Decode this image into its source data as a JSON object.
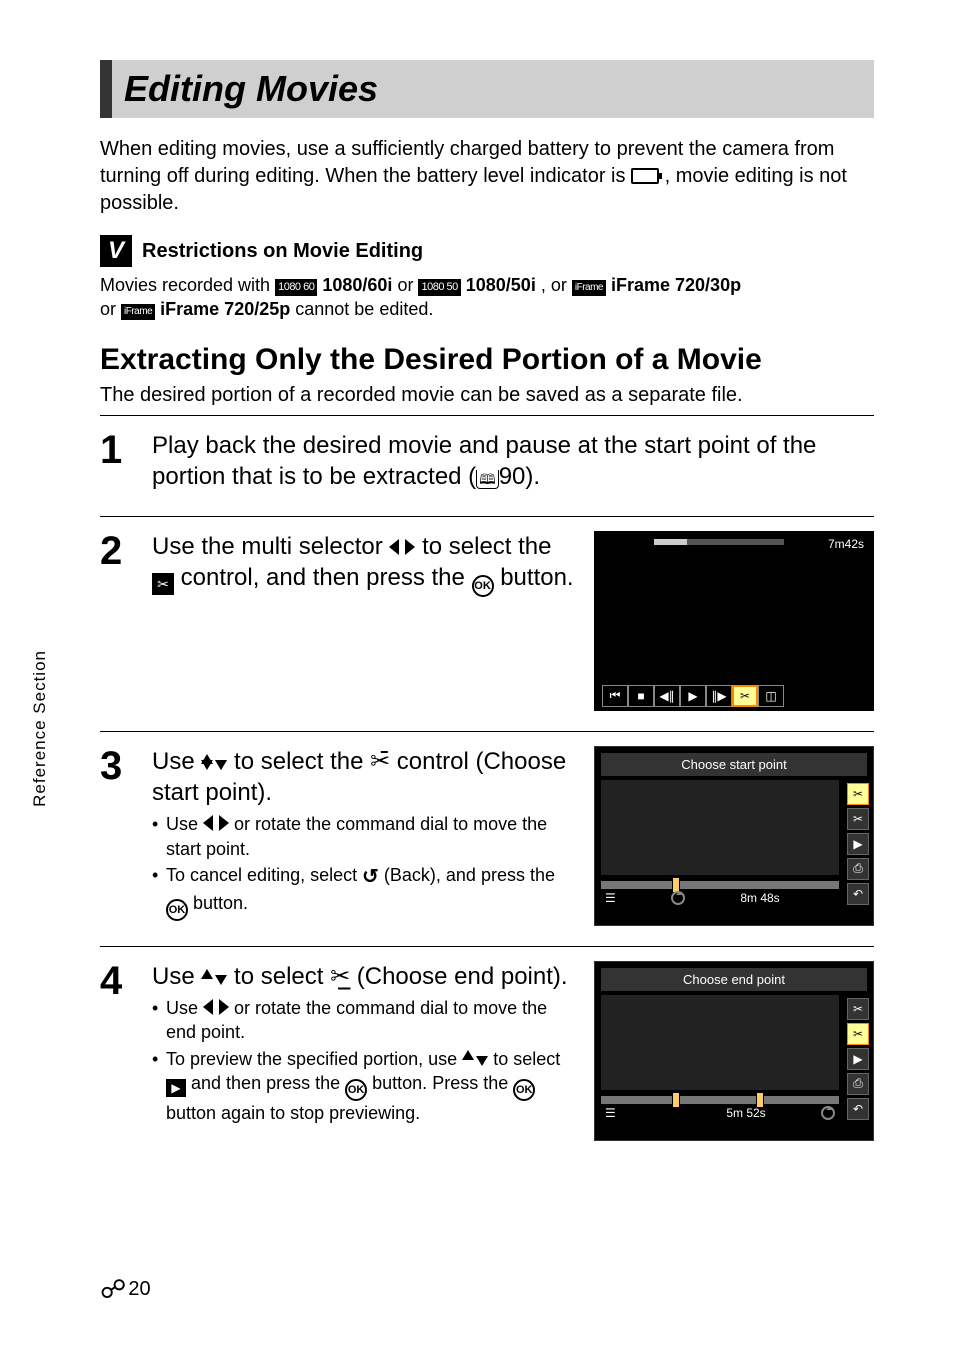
{
  "header": {
    "title": "Editing Movies"
  },
  "intro": {
    "text_before": "When editing movies, use a sufficiently charged battery to prevent the camera from turning off during editing. When the battery level indicator is ",
    "text_after": ", movie editing is not possible."
  },
  "note": {
    "badge": "V",
    "title": "Restrictions on Movie Editing",
    "line1_a": "Movies recorded with ",
    "fmt1": "1080/60i",
    "or1": " or ",
    "fmt2": "1080/50i",
    "or2": ", or ",
    "fmt3": "iFrame 720/30p",
    "line2_a": "or ",
    "fmt4": "iFrame 720/25p",
    "line2_b": " cannot be edited."
  },
  "sub": {
    "title": "Extracting Only the Desired Portion of a Movie",
    "desc": "The desired portion of a recorded movie can be saved as a separate file."
  },
  "steps": {
    "s1": {
      "num": "1",
      "title_a": "Play back the desired movie and pause at the start point of the portion that is to be extracted (",
      "ref": "90",
      "title_b": ")."
    },
    "s2": {
      "num": "2",
      "title_a": "Use the multi selector ",
      "title_b": " to select the ",
      "title_c": " control, and then press the ",
      "title_d": " button.",
      "ok": "OK",
      "scr": {
        "time": "7m42s"
      }
    },
    "s3": {
      "num": "3",
      "title_a": "Use ",
      "title_b": " to select the ",
      "title_c": " control (Choose start point).",
      "b1_a": "Use ",
      "b1_b": " or rotate the command dial to move the start point.",
      "b2_a": "To cancel editing, select ",
      "b2_b": " (Back), and press the ",
      "b2_c": " button.",
      "ok": "OK",
      "scr": {
        "title": "Choose start point",
        "time": "8m 48s"
      }
    },
    "s4": {
      "num": "4",
      "title_a": "Use ",
      "title_b": " to select ",
      "title_c": " (Choose end point).",
      "b1_a": "Use ",
      "b1_b": " or rotate the command dial to move the end point.",
      "b2_a": "To preview the specified portion, use ",
      "b2_b": " to select ",
      "b2_c": " and then press the ",
      "b2_d": " button. Press the ",
      "b2_e": " button again to stop previewing.",
      "ok": "OK",
      "scr": {
        "title": "Choose end point",
        "time": "5m 52s"
      }
    }
  },
  "side_tab": "Reference Section",
  "footer": {
    "page": "20"
  },
  "icons": {
    "fmt_label_1": "1080 60",
    "fmt_label_2": "1080 50",
    "fmt_label_3": "iFrame",
    "fmt_label_4": "iFrame"
  }
}
